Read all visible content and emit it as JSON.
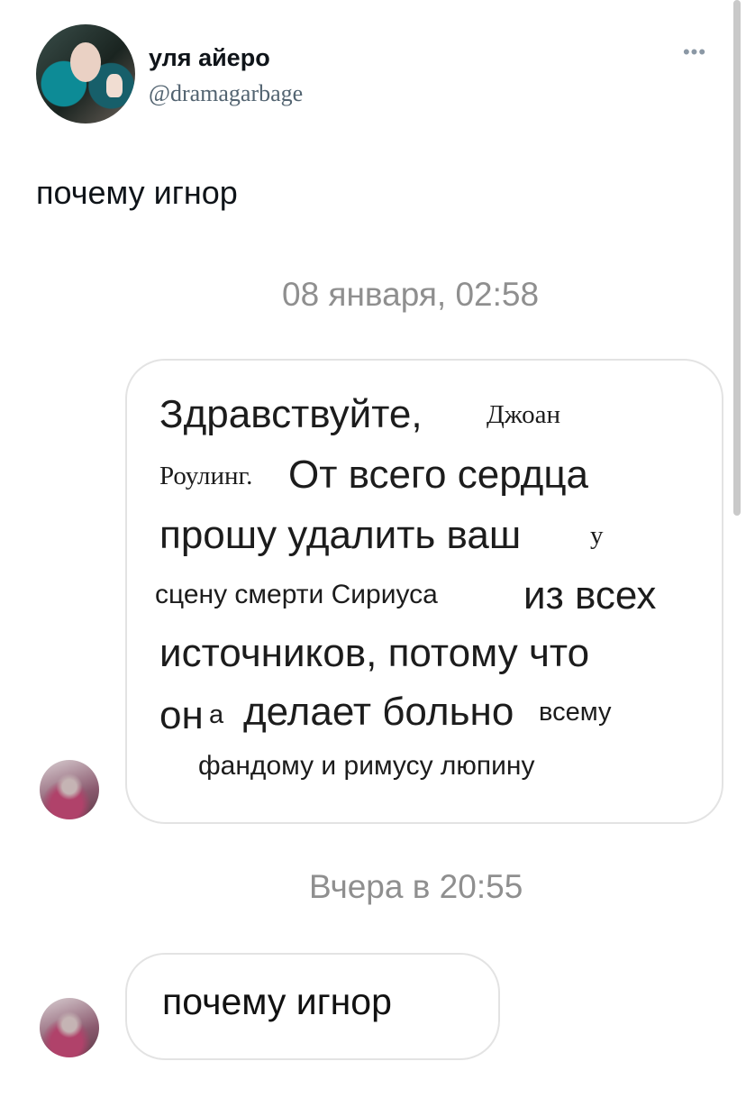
{
  "tweet": {
    "display_name": "уля айеро",
    "handle": "@dramagarbage",
    "text": "почему игнор",
    "more_icon": "more-horizontal-icon"
  },
  "chat": {
    "timestamp_1": "08 января, 02:58",
    "message_lines": [
      "Здравствуйте,",
      "Джоан",
      "Роулинг.",
      "От всего сердца",
      "прошу удалить ваш",
      "у",
      "сцену смерти Сириуса",
      "из всех",
      "источников, потому что",
      "он",
      "а",
      "делает больно",
      "всему",
      "фандому и римусу люпину"
    ],
    "timestamp_2": "Вчера в 20:55",
    "reply": "почему игнор"
  },
  "colors": {
    "timestamp": "#8f8f8f",
    "bubble_border": "#e3e3e3",
    "handle": "#536471"
  }
}
